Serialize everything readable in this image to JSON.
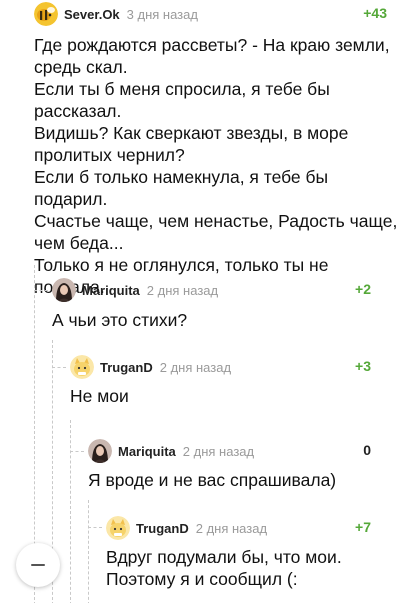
{
  "comments": [
    {
      "author": "Sever.Ok",
      "date": "3 дня назад",
      "rating": "+43",
      "avatar_icon": "bee-avatar-icon",
      "lines": [
        "Где рождаются рассветы? - На краю земли,",
        "средь скал.",
        "Если ты б меня спросила, я тебе бы",
        "рассказал.",
        "Видишь? Как сверкают звезды, в море",
        "пролитых чернил?",
        "Если б только намекнула, я тебе бы подарил.",
        "Счастье чаще, чем ненастье, Радость чаще,",
        "чем беда...",
        "Только я не оглянулся, только ты не позвала."
      ]
    },
    {
      "author": "Mariquita",
      "date": "2 дня назад",
      "rating": "+2",
      "avatar_icon": "user-photo-avatar-icon",
      "lines": [
        "А чьи это стихи?"
      ]
    },
    {
      "author": "TruganD",
      "date": "2 дня назад",
      "rating": "+3",
      "avatar_icon": "cat-avatar-icon",
      "lines": [
        "Не мои"
      ]
    },
    {
      "author": "Mariquita",
      "date": "2 дня назад",
      "rating": "0",
      "avatar_icon": "user-photo-avatar-icon",
      "lines": [
        "Я вроде и не вас спрашивала)"
      ]
    },
    {
      "author": "TruganD",
      "date": "2 дня назад",
      "rating": "+7",
      "avatar_icon": "cat-avatar-icon",
      "lines": [
        "Вдруг подумали бы, что мои.",
        "Поэтому я и сообщил (:"
      ]
    }
  ],
  "collapse_button_icon": "minus-icon",
  "colors": {
    "rating_positive": "#55a839",
    "meta_gray": "#9a9a9a",
    "thread_line": "#c9c9c9"
  }
}
